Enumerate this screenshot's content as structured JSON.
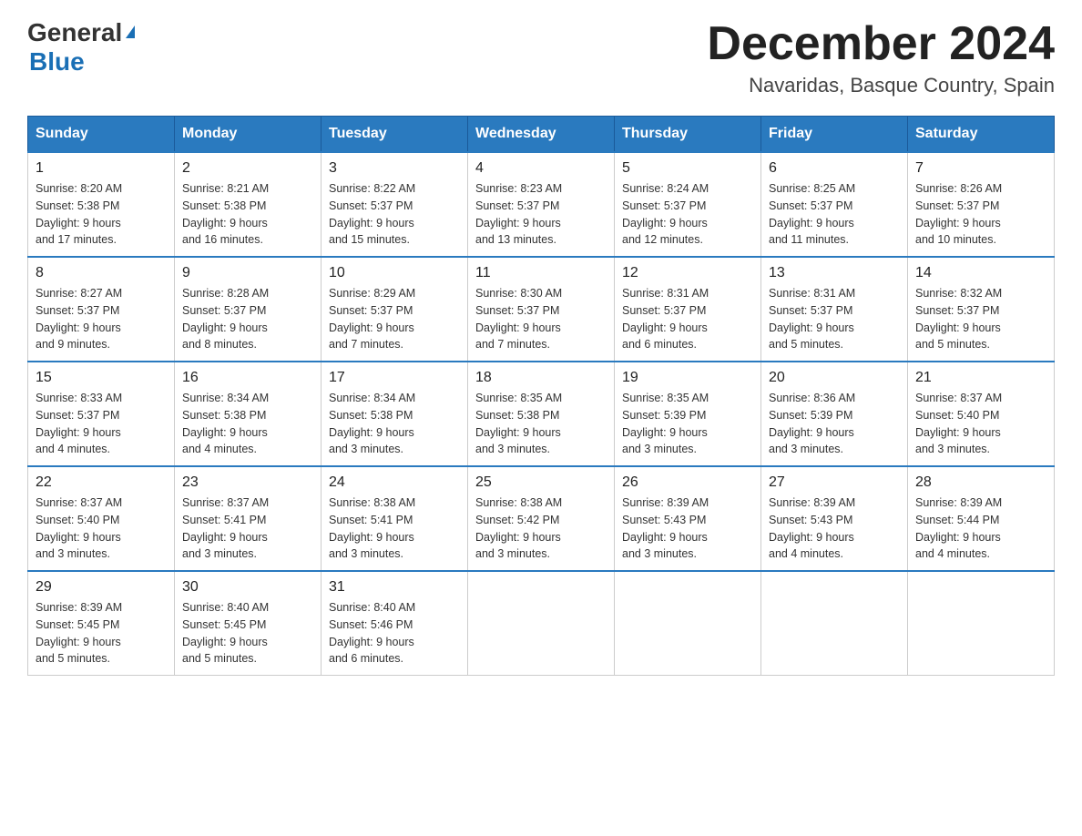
{
  "header": {
    "logo_general": "General",
    "logo_blue": "Blue",
    "month_title": "December 2024",
    "subtitle": "Navaridas, Basque Country, Spain"
  },
  "days_of_week": [
    "Sunday",
    "Monday",
    "Tuesday",
    "Wednesday",
    "Thursday",
    "Friday",
    "Saturday"
  ],
  "weeks": [
    [
      {
        "day": "1",
        "sunrise": "8:20 AM",
        "sunset": "5:38 PM",
        "daylight": "9 hours and 17 minutes."
      },
      {
        "day": "2",
        "sunrise": "8:21 AM",
        "sunset": "5:38 PM",
        "daylight": "9 hours and 16 minutes."
      },
      {
        "day": "3",
        "sunrise": "8:22 AM",
        "sunset": "5:37 PM",
        "daylight": "9 hours and 15 minutes."
      },
      {
        "day": "4",
        "sunrise": "8:23 AM",
        "sunset": "5:37 PM",
        "daylight": "9 hours and 13 minutes."
      },
      {
        "day": "5",
        "sunrise": "8:24 AM",
        "sunset": "5:37 PM",
        "daylight": "9 hours and 12 minutes."
      },
      {
        "day": "6",
        "sunrise": "8:25 AM",
        "sunset": "5:37 PM",
        "daylight": "9 hours and 11 minutes."
      },
      {
        "day": "7",
        "sunrise": "8:26 AM",
        "sunset": "5:37 PM",
        "daylight": "9 hours and 10 minutes."
      }
    ],
    [
      {
        "day": "8",
        "sunrise": "8:27 AM",
        "sunset": "5:37 PM",
        "daylight": "9 hours and 9 minutes."
      },
      {
        "day": "9",
        "sunrise": "8:28 AM",
        "sunset": "5:37 PM",
        "daylight": "9 hours and 8 minutes."
      },
      {
        "day": "10",
        "sunrise": "8:29 AM",
        "sunset": "5:37 PM",
        "daylight": "9 hours and 7 minutes."
      },
      {
        "day": "11",
        "sunrise": "8:30 AM",
        "sunset": "5:37 PM",
        "daylight": "9 hours and 7 minutes."
      },
      {
        "day": "12",
        "sunrise": "8:31 AM",
        "sunset": "5:37 PM",
        "daylight": "9 hours and 6 minutes."
      },
      {
        "day": "13",
        "sunrise": "8:31 AM",
        "sunset": "5:37 PM",
        "daylight": "9 hours and 5 minutes."
      },
      {
        "day": "14",
        "sunrise": "8:32 AM",
        "sunset": "5:37 PM",
        "daylight": "9 hours and 5 minutes."
      }
    ],
    [
      {
        "day": "15",
        "sunrise": "8:33 AM",
        "sunset": "5:37 PM",
        "daylight": "9 hours and 4 minutes."
      },
      {
        "day": "16",
        "sunrise": "8:34 AM",
        "sunset": "5:38 PM",
        "daylight": "9 hours and 4 minutes."
      },
      {
        "day": "17",
        "sunrise": "8:34 AM",
        "sunset": "5:38 PM",
        "daylight": "9 hours and 3 minutes."
      },
      {
        "day": "18",
        "sunrise": "8:35 AM",
        "sunset": "5:38 PM",
        "daylight": "9 hours and 3 minutes."
      },
      {
        "day": "19",
        "sunrise": "8:35 AM",
        "sunset": "5:39 PM",
        "daylight": "9 hours and 3 minutes."
      },
      {
        "day": "20",
        "sunrise": "8:36 AM",
        "sunset": "5:39 PM",
        "daylight": "9 hours and 3 minutes."
      },
      {
        "day": "21",
        "sunrise": "8:37 AM",
        "sunset": "5:40 PM",
        "daylight": "9 hours and 3 minutes."
      }
    ],
    [
      {
        "day": "22",
        "sunrise": "8:37 AM",
        "sunset": "5:40 PM",
        "daylight": "9 hours and 3 minutes."
      },
      {
        "day": "23",
        "sunrise": "8:37 AM",
        "sunset": "5:41 PM",
        "daylight": "9 hours and 3 minutes."
      },
      {
        "day": "24",
        "sunrise": "8:38 AM",
        "sunset": "5:41 PM",
        "daylight": "9 hours and 3 minutes."
      },
      {
        "day": "25",
        "sunrise": "8:38 AM",
        "sunset": "5:42 PM",
        "daylight": "9 hours and 3 minutes."
      },
      {
        "day": "26",
        "sunrise": "8:39 AM",
        "sunset": "5:43 PM",
        "daylight": "9 hours and 3 minutes."
      },
      {
        "day": "27",
        "sunrise": "8:39 AM",
        "sunset": "5:43 PM",
        "daylight": "9 hours and 4 minutes."
      },
      {
        "day": "28",
        "sunrise": "8:39 AM",
        "sunset": "5:44 PM",
        "daylight": "9 hours and 4 minutes."
      }
    ],
    [
      {
        "day": "29",
        "sunrise": "8:39 AM",
        "sunset": "5:45 PM",
        "daylight": "9 hours and 5 minutes."
      },
      {
        "day": "30",
        "sunrise": "8:40 AM",
        "sunset": "5:45 PM",
        "daylight": "9 hours and 5 minutes."
      },
      {
        "day": "31",
        "sunrise": "8:40 AM",
        "sunset": "5:46 PM",
        "daylight": "9 hours and 6 minutes."
      },
      null,
      null,
      null,
      null
    ]
  ],
  "labels": {
    "sunrise": "Sunrise:",
    "sunset": "Sunset:",
    "daylight": "Daylight:"
  }
}
